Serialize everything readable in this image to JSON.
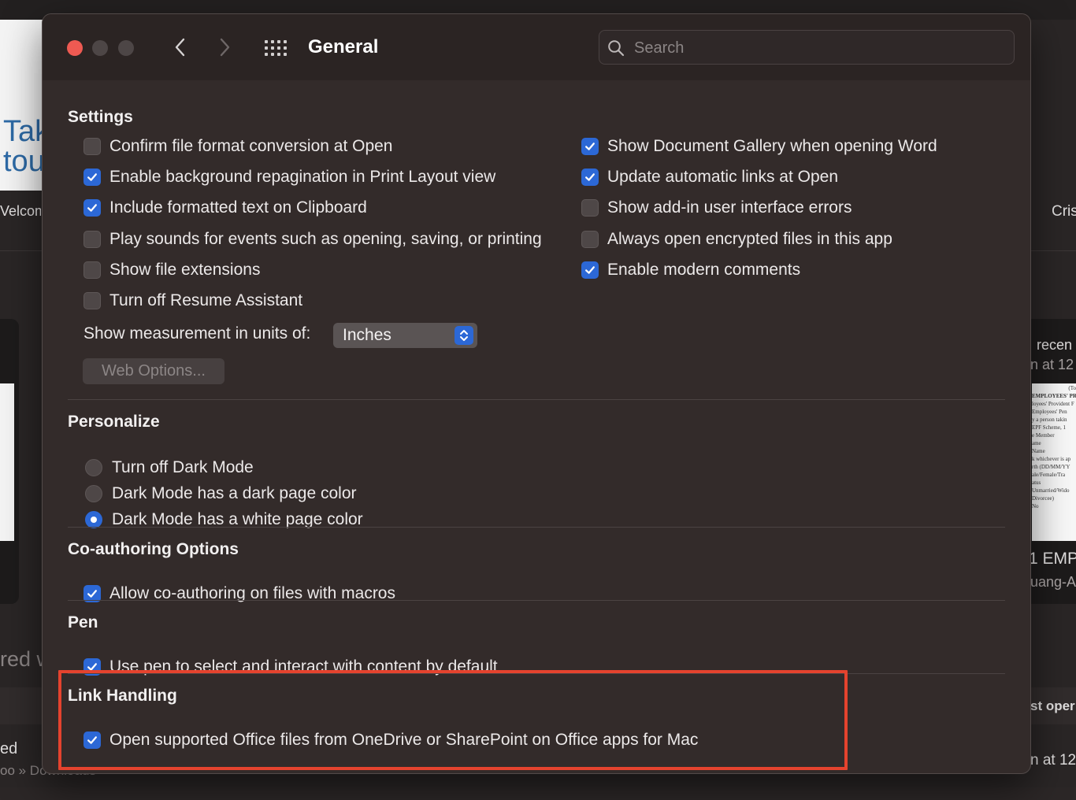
{
  "background": {
    "left_card_text": [
      "Tak",
      "tou"
    ],
    "left_welcome": "Velcom",
    "left_pinned": "red w",
    "left_item_title": "ed",
    "left_item_path": "oo » Downloads",
    "right_name": "Cris",
    "right_recent_title": "recen",
    "right_recent_time": "n at 12",
    "right_doc_lines": [
      "(To",
      "EMPLOYEES' PR",
      "loyees' Provident F",
      "Employees' Pen",
      "y a person takin",
      "EPF Scheme, 1",
      "e Member",
      "ame",
      "Name",
      "k whichever is ap",
      "rth (DD/MM/YY",
      "ale/Female/Tra",
      "atus",
      "Unmarried/Wido",
      "Divorcee)",
      "No"
    ],
    "right_doc_title": "1 EMP",
    "right_doc_author": "uang-A",
    "right_open_label": "st oper",
    "right_bottom_time": "n at 12"
  },
  "window": {
    "title": "General",
    "search_placeholder": "Search",
    "back_label": "Back",
    "forward_label": "Forward",
    "show_all_label": "Show All"
  },
  "sections": {
    "settings": {
      "title": "Settings",
      "left_options": [
        {
          "label": "Confirm file format conversion at Open",
          "checked": false
        },
        {
          "label": "Enable background repagination in Print Layout view",
          "checked": true
        },
        {
          "label": "Include formatted text on Clipboard",
          "checked": true
        },
        {
          "label": "Play sounds for events such as opening, saving, or printing",
          "checked": false
        },
        {
          "label": "Show file extensions",
          "checked": false
        },
        {
          "label": "Turn off Resume Assistant",
          "checked": false
        }
      ],
      "right_options": [
        {
          "label": "Show Document Gallery when opening Word",
          "checked": true
        },
        {
          "label": "Update automatic links at Open",
          "checked": true
        },
        {
          "label": "Show add-in user interface errors",
          "checked": false
        },
        {
          "label": "Always open encrypted files in this app",
          "checked": false
        },
        {
          "label": "Enable modern comments",
          "checked": true
        }
      ],
      "units_label": "Show measurement in units of:",
      "units_value": "Inches",
      "web_options_label": "Web Options..."
    },
    "personalize": {
      "title": "Personalize",
      "radios": [
        {
          "label": "Turn off Dark Mode",
          "selected": false
        },
        {
          "label": "Dark Mode has a dark page color",
          "selected": false
        },
        {
          "label": "Dark Mode has a white page color",
          "selected": true
        }
      ]
    },
    "coauthoring": {
      "title": "Co-authoring Options",
      "options": [
        {
          "label": "Allow co-authoring on files with macros",
          "checked": true
        }
      ]
    },
    "pen": {
      "title": "Pen",
      "options": [
        {
          "label": "Use pen to select and interact with content by default",
          "checked": true
        }
      ]
    },
    "link_handling": {
      "title": "Link Handling",
      "options": [
        {
          "label": "Open supported Office files from OneDrive or SharePoint on Office apps for Mac",
          "checked": true
        }
      ]
    }
  },
  "colors": {
    "accent": "#2c68d6",
    "close_button": "#ee5a52",
    "highlight_box": "#e5432e",
    "window_bg": "#332b2a"
  }
}
